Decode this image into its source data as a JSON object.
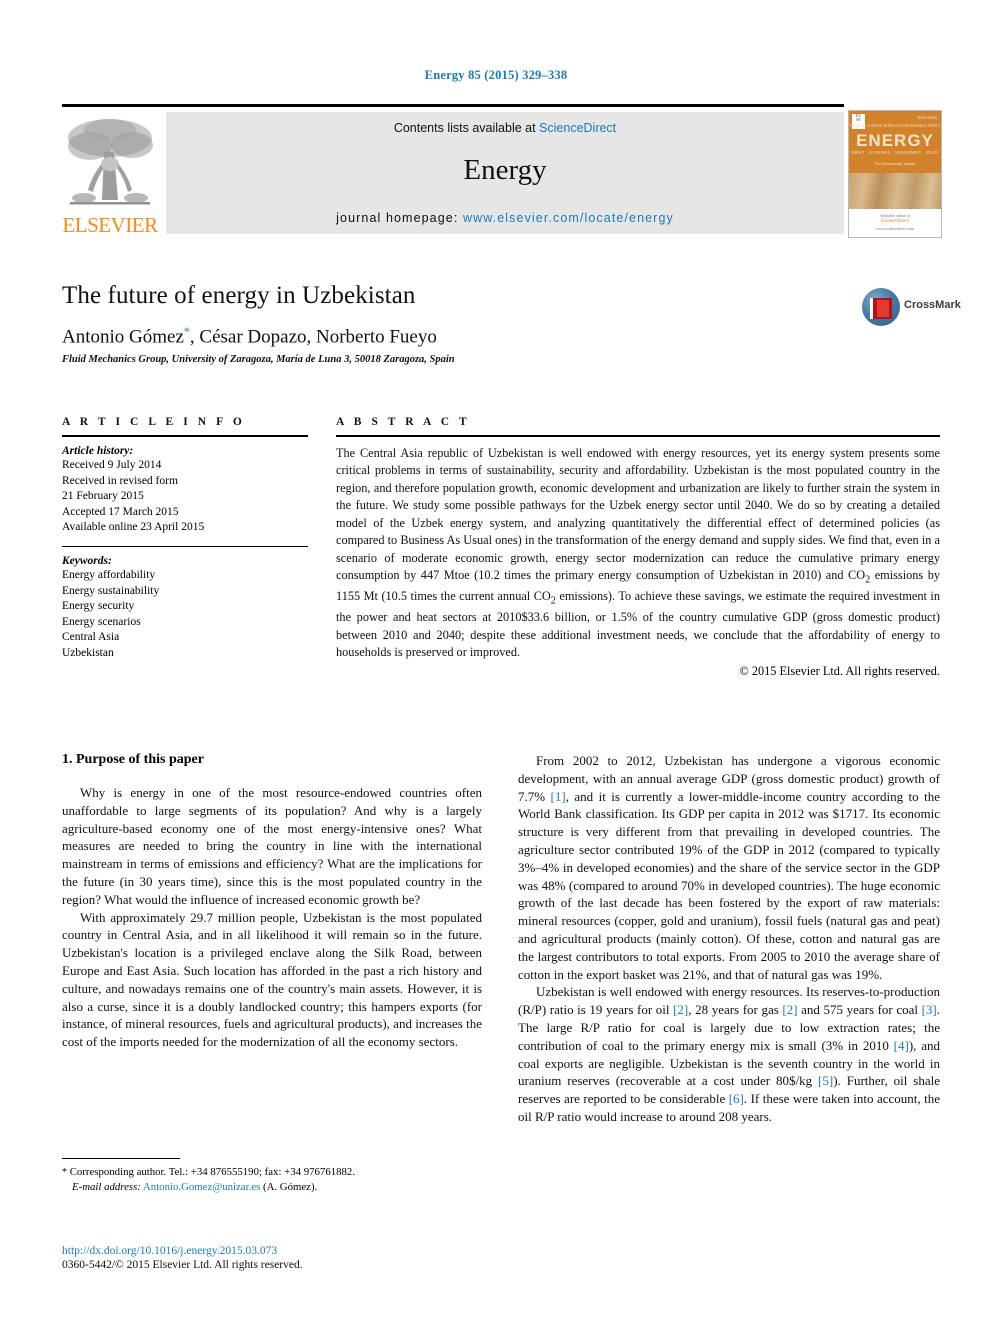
{
  "running_head": "Energy 85 (2015) 329–338",
  "masthead": {
    "contents_prefix": "Contents lists available at ",
    "sciencedirect": "ScienceDirect",
    "journal_title": "Energy",
    "homepage_prefix": "journal homepage: ",
    "homepage_url": "www.elsevier.com/locate/energy",
    "publisher_wordmark": "ELSEVIER",
    "publisher_logo_icon": "elsevier-tree-icon",
    "accent_blue": "#1a7bb9",
    "accent_orange": "#F08C22"
  },
  "cover": {
    "journal_name": "ENERGY",
    "issue_label": "ISSN 00360",
    "tagline": "The International Journal",
    "top_tags": [
      "THERMAL SCIENCE",
      "MODELLING",
      "RENEWABLE",
      "SUPPLY"
    ],
    "bottom_tags": [
      "IMPACT",
      "ECONOMICS",
      "MANAGEMENT",
      "POLICY"
    ],
    "footer_line1": "Available online at",
    "footer_line2": "ScienceDirect",
    "footer_line3": "www.sciencedirect.com"
  },
  "article": {
    "title": "The future of energy in Uzbekistan",
    "authors": "Antonio Gómez",
    "authors_rest": ", César Dopazo, Norberto Fueyo",
    "corresponding_marker": "*",
    "affiliation": "Fluid Mechanics Group, University of Zaragoza, María de Luna 3, 50018 Zaragoza, Spain"
  },
  "crossmark": {
    "label": "CrossMark",
    "icon": "crossmark-icon"
  },
  "article_info": {
    "heading": "A R T I C L E   I N F O",
    "history_label": "Article history:",
    "history": [
      "Received 9 July 2014",
      "Received in revised form",
      "21 February 2015",
      "Accepted 17 March 2015",
      "Available online 23 April 2015"
    ],
    "keywords_label": "Keywords:",
    "keywords": [
      "Energy affordability",
      "Energy sustainability",
      "Energy security",
      "Energy scenarios",
      "Central Asia",
      "Uzbekistan"
    ]
  },
  "abstract": {
    "heading": "A B S T R A C T",
    "text": "The Central Asia republic of Uzbekistan is well endowed with energy resources, yet its energy system presents some critical problems in terms of sustainability, security and affordability. Uzbekistan is the most populated country in the region, and therefore population growth, economic development and urbanization are likely to further strain the system in the future. We study some possible pathways for the Uzbek energy sector until 2040. We do so by creating a detailed model of the Uzbek energy system, and analyzing quantitatively the differential effect of determined policies (as compared to Business As Usual ones) in the transformation of the energy demand and supply sides. We find that, even in a scenario of moderate economic growth, energy sector modernization can reduce the cumulative primary energy consumption by 447 Mtoe (10.2 times the primary energy consumption of Uzbekistan in 2010) and CO2 emissions by 1155 Mt (10.5 times the current annual CO2 emissions). To achieve these savings, we estimate the required investment in the power and heat sectors at 2010$33.6 billion, or 1.5% of the country cumulative GDP (gross domestic product) between 2010 and 2040; despite these additional investment needs, we conclude that the affordability of energy to households is preserved or improved.",
    "copyright": "© 2015 Elsevier Ltd. All rights reserved."
  },
  "body": {
    "section_number_title": "1. Purpose of this paper",
    "left_paragraphs": [
      "Why is energy in one of the most resource-endowed countries often unaffordable to large segments of its population? And why is a largely agriculture-based economy one of the most energy-intensive ones? What measures are needed to bring the country in line with the international mainstream in terms of emissions and efficiency? What are the implications for the future (in 30 years time), since this is the most populated country in the region? What would the influence of increased economic growth be?",
      "With approximately 29.7 million people, Uzbekistan is the most populated country in Central Asia, and in all likelihood it will remain so in the future. Uzbekistan's location is a privileged enclave along the Silk Road, between Europe and East Asia. Such location has afforded in the past a rich history and culture, and nowadays remains one of the country's main assets. However, it is also a curse, since it is a doubly landlocked country; this hampers exports (for instance, of mineral resources, fuels and agricultural products), and increases the cost of the imports needed for the modernization of all the economy sectors."
    ],
    "right_paragraph_1": "From 2002 to 2012, Uzbekistan has undergone a vigorous economic development, with an annual average GDP (gross domestic product) growth of 7.7% [1], and it is currently a lower-middle-income country according to the World Bank classification. Its GDP per capita in 2012 was $1717. Its economic structure is very different from that prevailing in developed countries. The agriculture sector contributed 19% of the GDP in 2012 (compared to typically 3%–4% in developed economies) and the share of the service sector in the GDP was 48% (compared to around 70% in developed countries). The huge economic growth of the last decade has been fostered by the export of raw materials: mineral resources (copper, gold and uranium), fossil fuels (natural gas and peat) and agricultural products (mainly cotton). Of these, cotton and natural gas are the largest contributors to total exports. From 2005 to 2010 the average share of cotton in the export basket was 21%, and that of natural gas was 19%.",
    "right_paragraph_2": "Uzbekistan is well endowed with energy resources. Its reserves-to-production (R/P) ratio is 19 years for oil [2], 28 years for gas [2] and 575 years for coal [3]. The large R/P ratio for coal is largely due to low extraction rates; the contribution of coal to the primary energy mix is small (3% in 2010 [4]), and coal exports are negligible. Uzbekistan is the seventh country in the world in uranium reserves (recoverable at a cost under 80$/kg [5]). Further, oil shale reserves are reported to be considerable [6]. If these were taken into account, the oil R/P ratio would increase to around 208 years."
  },
  "footnote": {
    "marker": "*",
    "corresponding": " Corresponding author. Tel.: +34 876555190; fax: +34 976761882.",
    "email_label": "E-mail address:",
    "email": "Antonio.Gomez@unizar.es",
    "email_suffix": " (A. Gómez)."
  },
  "doi": {
    "url": "http://dx.doi.org/10.1016/j.energy.2015.03.073",
    "issn_line": "0360-5442/© 2015 Elsevier Ltd. All rights reserved."
  }
}
